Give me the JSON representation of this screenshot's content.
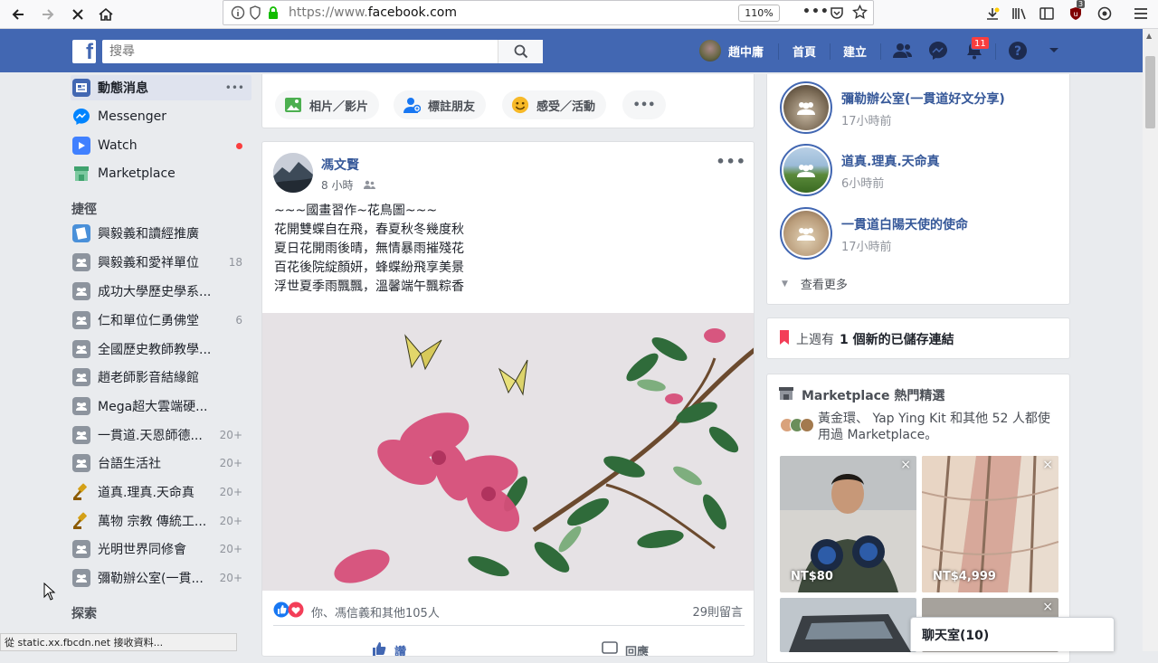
{
  "browser": {
    "url_prefix": "https://www.",
    "url_domain": "facebook.com",
    "zoom": "110%",
    "ext_badge": "3",
    "status_text": "從 static.xx.fbcdn.net 接收資料..."
  },
  "fb_header": {
    "logo": "f",
    "search_placeholder": "搜尋",
    "user_name": "趙中庸",
    "home_label": "首頁",
    "create_label": "建立",
    "notif_count": "11"
  },
  "sidebar": {
    "main_items": [
      {
        "label": "動態消息",
        "more": "•••"
      },
      {
        "label": "Messenger"
      },
      {
        "label": "Watch"
      },
      {
        "label": "Marketplace"
      }
    ],
    "shortcuts_header": "捷徑",
    "shortcuts": [
      {
        "label": "興毅義和讀經推廣",
        "count": ""
      },
      {
        "label": "興毅義和愛祥單位",
        "count": "18"
      },
      {
        "label": "成功大學歷史學系...",
        "count": ""
      },
      {
        "label": "仁和單位仁勇佛堂",
        "count": "6"
      },
      {
        "label": "全國歷史教師教學...",
        "count": ""
      },
      {
        "label": "趙老師影音結緣館",
        "count": ""
      },
      {
        "label": "Mega超大雲端硬...",
        "count": ""
      },
      {
        "label": "一貫道.天恩師德...",
        "count": "20+"
      },
      {
        "label": "台語生活社",
        "count": "20+"
      },
      {
        "label": "道真.理真.天命真",
        "count": "20+"
      },
      {
        "label": "萬物 宗教 傳統工...",
        "count": "20+"
      },
      {
        "label": "光明世界同修會",
        "count": "20+"
      },
      {
        "label": "彌勒辦公室(一貫...",
        "count": "20+"
      }
    ],
    "explore_header": "探索"
  },
  "composer": {
    "photo_label": "相片／影片",
    "tag_label": "標註朋友",
    "feeling_label": "感受／活動",
    "more": "•••"
  },
  "post": {
    "author": "馮文賢",
    "time": "8 小時",
    "more": "•••",
    "lines": [
      "~~~國畫習作~花鳥圖~~~",
      "花開雙蝶自在飛，春夏秋冬幾度秋",
      "夏日花開雨後晴，無情暴雨摧殘花",
      "百花後院綻顏妍，蜂蝶紛飛享美景",
      "浮世夏季雨飄飄，溫馨端午飄粽香"
    ],
    "reactions": "你、馮信義和其他105人",
    "comments": "29則留言",
    "like_label": "讚",
    "reply_label": "回應"
  },
  "right": {
    "groups": [
      {
        "name": "彌勒辦公室(一貫道好文分享)",
        "time": "17小時前"
      },
      {
        "name": "道真.理真.天命真",
        "time": "6小時前"
      },
      {
        "name": "一貫道白陽天使的使命",
        "time": "17小時前"
      }
    ],
    "see_more": "查看更多",
    "saved_prefix": "上週有",
    "saved_bold": "1 個新的已儲存連結",
    "marketplace_title": "Marketplace 熱門精選",
    "marketplace_desc": "黃金環、 Yap Ying Kit 和其他 52 人都使用過 Marketplace。",
    "tiles": [
      {
        "price": "NT$80"
      },
      {
        "price": "NT$4,999"
      }
    ],
    "close": "×"
  },
  "chat": {
    "title": "聊天室(10)"
  }
}
